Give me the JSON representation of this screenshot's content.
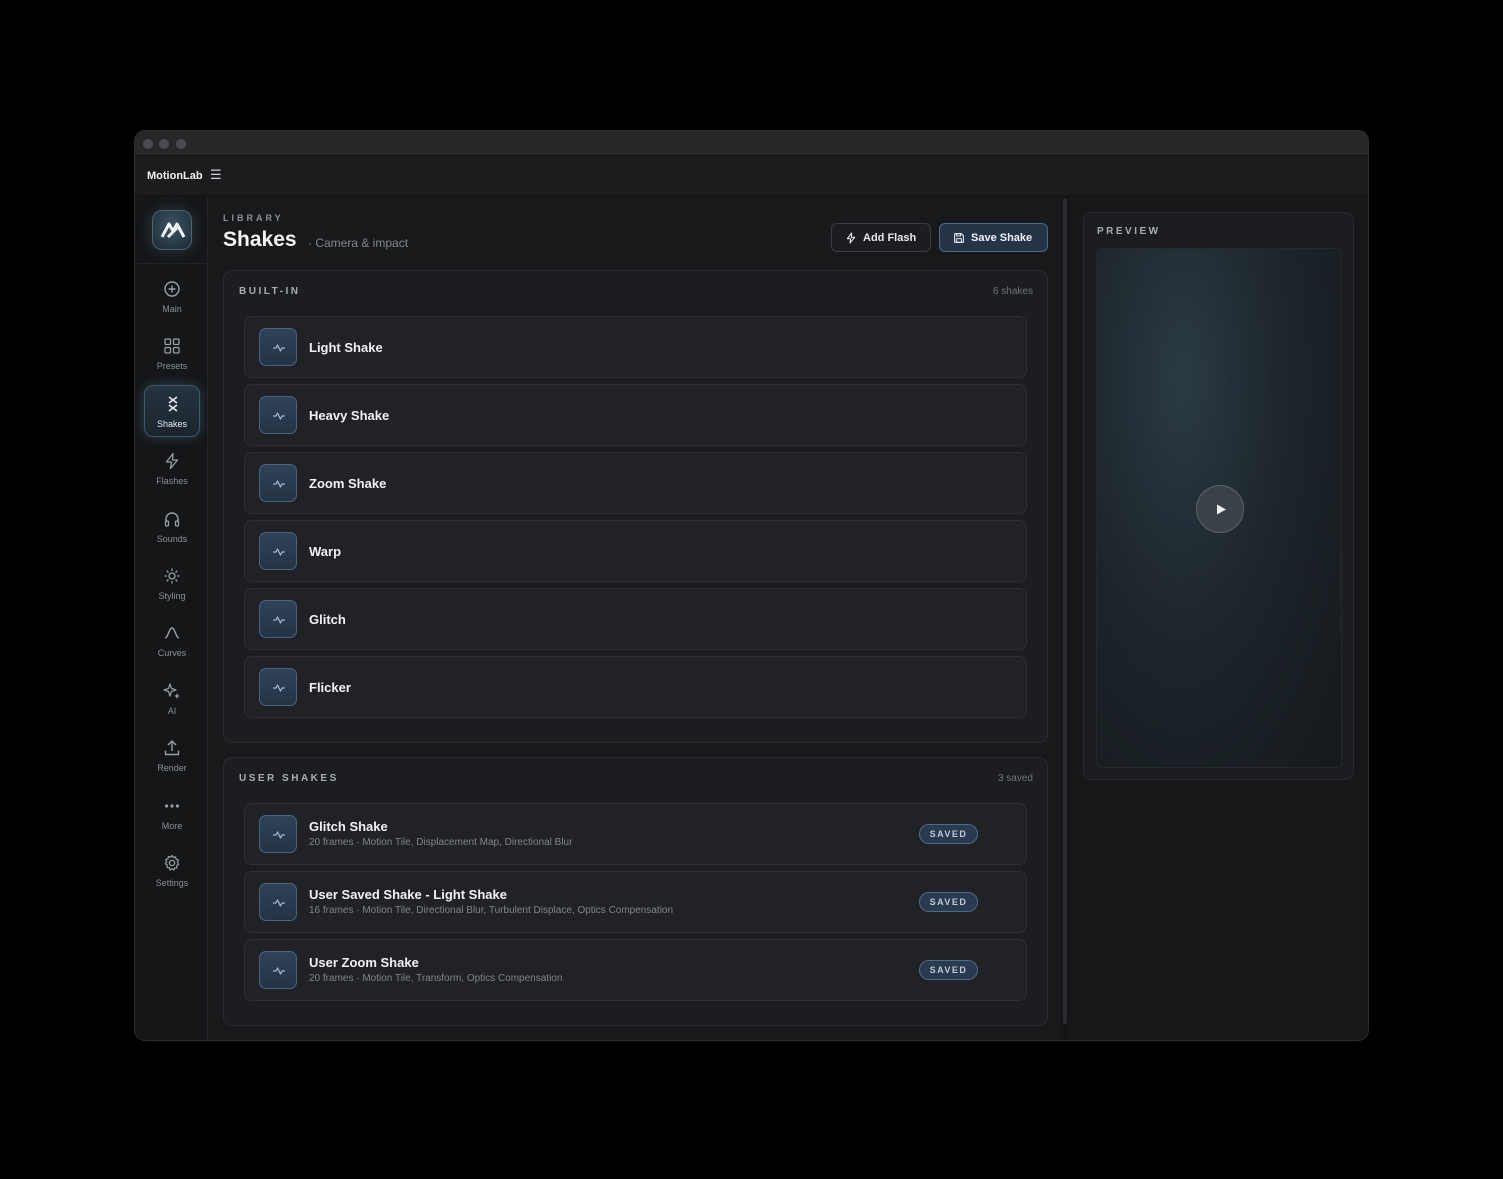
{
  "app": {
    "name": "MotionLab"
  },
  "sidebar": {
    "items": [
      {
        "label": "Main",
        "icon": "plus-circle-icon",
        "active": false
      },
      {
        "label": "Presets",
        "icon": "grid-icon",
        "active": false
      },
      {
        "label": "Shakes",
        "icon": "shake-x-icon",
        "active": true
      },
      {
        "label": "Flashes",
        "icon": "lightning-icon",
        "active": false
      },
      {
        "label": "Sounds",
        "icon": "headphones-icon",
        "active": false
      },
      {
        "label": "Styling",
        "icon": "sun-icon",
        "active": false
      },
      {
        "label": "Curves",
        "icon": "curve-icon",
        "active": false
      },
      {
        "label": "AI",
        "icon": "sparkle-icon",
        "active": false
      },
      {
        "label": "Render",
        "icon": "upload-icon",
        "active": false
      },
      {
        "label": "More",
        "icon": "more-dots-icon",
        "active": false
      },
      {
        "label": "Settings",
        "icon": "gear-icon",
        "active": false
      }
    ]
  },
  "header": {
    "breadcrumb": "LIBRARY",
    "title": "Shakes",
    "subtitle": "· Camera & impact",
    "add_flash_label": "Add Flash",
    "save_shake_label": "Save Shake"
  },
  "builtin": {
    "title": "BUILT-IN",
    "count": "6 shakes",
    "items": [
      {
        "name": "Light Shake"
      },
      {
        "name": "Heavy Shake"
      },
      {
        "name": "Zoom Shake"
      },
      {
        "name": "Warp"
      },
      {
        "name": "Glitch"
      },
      {
        "name": "Flicker"
      }
    ]
  },
  "user": {
    "title": "USER SHAKES",
    "count": "3 saved",
    "badge": "SAVED",
    "items": [
      {
        "name": "Glitch Shake",
        "meta": "20 frames · Motion Tile, Displacement Map, Directional Blur"
      },
      {
        "name": "User Saved Shake - Light Shake",
        "meta": "16 frames · Motion Tile, Directional Blur, Turbulent Displace, Optics Compensation"
      },
      {
        "name": "User Zoom Shake",
        "meta": "20 frames · Motion Tile, Transform, Optics Compensation"
      }
    ]
  },
  "preview": {
    "title": "PREVIEW"
  },
  "colors": {
    "accent": "#4c6a8a",
    "background": "#18191b",
    "badge": "#2a3b4f"
  }
}
